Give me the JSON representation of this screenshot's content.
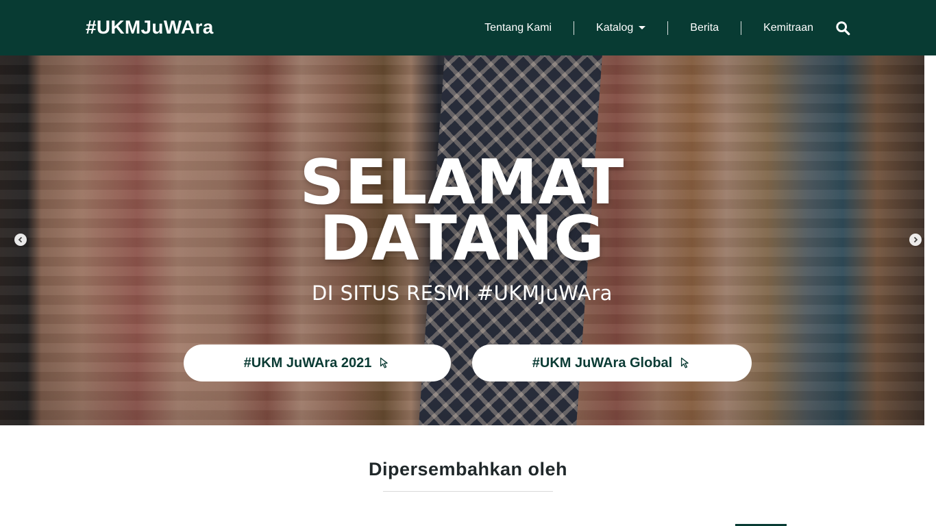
{
  "navbar": {
    "brand": "#UKMJuWAra",
    "links": [
      "Tentang Kami",
      "Katalog",
      "Berita",
      "Kemitraan"
    ],
    "search_icon": "search-icon"
  },
  "hero": {
    "title_line1": "SELAMAT",
    "title_line2": "DATANG",
    "subtitle": "DI SITUS RESMI #UKMJuWAra",
    "buttons": [
      "#UKM JuWAra 2021",
      "#UKM JuWAra Global"
    ],
    "button_icon": "cursor-pointer-icon",
    "arrows": [
      "chevron-left-icon",
      "chevron-right-icon"
    ]
  },
  "section": {
    "title": "Dipersembahkan oleh"
  },
  "colors": {
    "primary": "#083b33",
    "white": "#ffffff"
  }
}
